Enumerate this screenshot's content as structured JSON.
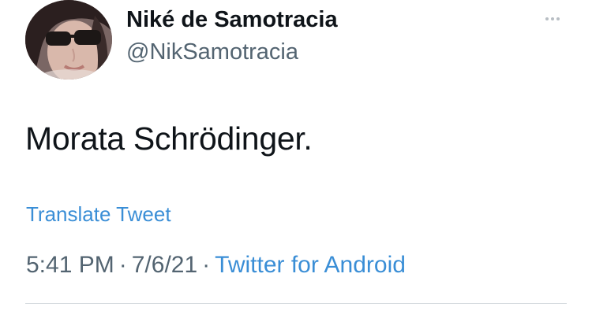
{
  "author": {
    "name": "Niké de Samotracia",
    "handle": "@NikSamotracia"
  },
  "tweet": {
    "text": "Morata Schrödinger.",
    "translate_label": "Translate Tweet",
    "time": "5:41 PM",
    "date": "7/6/21",
    "separator": "·",
    "source": "Twitter for Android"
  },
  "icons": {
    "more": "more-horizontal-icon"
  },
  "colors": {
    "name": "#0f1419",
    "secondary": "#536471",
    "link": "#3a8ed6",
    "divider": "#d4d9dd"
  }
}
